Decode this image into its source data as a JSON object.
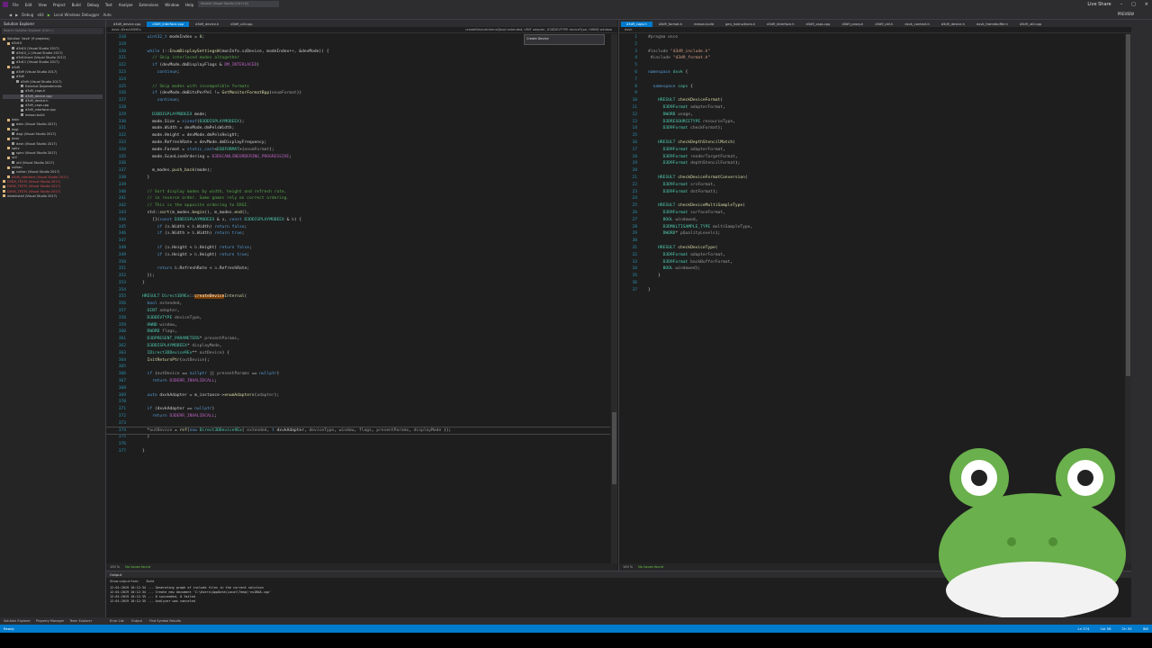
{
  "menu": [
    "File",
    "Edit",
    "View",
    "Project",
    "Build",
    "Debug",
    "Test",
    "Analyze",
    "Extensions",
    "Window",
    "Help"
  ],
  "toolbar": [
    "Debug",
    "x64",
    "Local Windows Debugger",
    "Auto"
  ],
  "search_placeholder": "Search Visual Studio (Ctrl+Q)",
  "window_controls": {
    "live_share": "Live Share",
    "preview": "PREVIEW"
  },
  "solution_explorer": {
    "title": "Solution Explorer",
    "search_placeholder": "Search Solution Explorer (Ctrl+;)",
    "items": [
      {
        "label": "Solution 'dxvk' (9 projects)",
        "indent": 0,
        "color": "#c8c8c8",
        "sel": false
      },
      {
        "label": "d3d10",
        "indent": 1,
        "color": "#c8c8c8",
        "sel": false
      },
      {
        "label": "d3d10 (Visual Studio 2017)",
        "indent": 2,
        "color": "#c8c8c8",
        "sel": false
      },
      {
        "label": "d3d10_1 (Visual Studio 2017)",
        "indent": 2,
        "color": "#c8c8c8",
        "sel": false
      },
      {
        "label": "d3d10core (Visual Studio 2017)",
        "indent": 2,
        "color": "#c8c8c8",
        "sel": false
      },
      {
        "label": "d3d11 (Visual Studio 2017)",
        "indent": 2,
        "color": "#c8c8c8",
        "sel": false
      },
      {
        "label": "d3d9",
        "indent": 1,
        "color": "#c8c8c8",
        "sel": false
      },
      {
        "label": "d3d9 (Visual Studio 2017)",
        "indent": 2,
        "color": "#c8c8c8",
        "sel": false
      },
      {
        "label": "d3d9",
        "indent": 2,
        "color": "#c8c8c8",
        "sel": false
      },
      {
        "label": "d3d9 (Visual Studio 2017)",
        "indent": 3,
        "color": "#c8c8c8",
        "sel": false
      },
      {
        "label": "External Dependencies",
        "indent": 4,
        "color": "#c8c8c8",
        "sel": false
      },
      {
        "label": "d3d9_caps.h",
        "indent": 4,
        "color": "#c8c8c8",
        "sel": false
      },
      {
        "label": "d3d9_device.cpp",
        "indent": 4,
        "color": "#c8c8c8",
        "sel": true
      },
      {
        "label": "d3d9_device.h",
        "indent": 4,
        "color": "#c8c8c8",
        "sel": false
      },
      {
        "label": "d3d9_caps.cpp",
        "indent": 4,
        "color": "#c8c8c8",
        "sel": false
      },
      {
        "label": "d3d9_interface.cpp",
        "indent": 4,
        "color": "#c8c8c8",
        "sel": false
      },
      {
        "label": "meson.build",
        "indent": 4,
        "color": "#c8c8c8",
        "sel": false
      },
      {
        "label": "dxbc",
        "indent": 1,
        "color": "#c8c8c8",
        "sel": false
      },
      {
        "label": "dxbc (Visual Studio 2017)",
        "indent": 2,
        "color": "#c8c8c8",
        "sel": false
      },
      {
        "label": "dxgi",
        "indent": 1,
        "color": "#c8c8c8",
        "sel": false
      },
      {
        "label": "dxgi (Visual Studio 2017)",
        "indent": 2,
        "color": "#c8c8c8",
        "sel": false
      },
      {
        "label": "dxvk",
        "indent": 1,
        "color": "#c8c8c8",
        "sel": false
      },
      {
        "label": "dxvk (Visual Studio 2017)",
        "indent": 2,
        "color": "#c8c8c8",
        "sel": false
      },
      {
        "label": "spirv",
        "indent": 1,
        "color": "#c8c8c8",
        "sel": false
      },
      {
        "label": "spirv (Visual Studio 2017)",
        "indent": 2,
        "color": "#c8c8c8",
        "sel": false
      },
      {
        "label": "util",
        "indent": 1,
        "color": "#c8c8c8",
        "sel": false
      },
      {
        "label": "util (Visual Studio 2017)",
        "indent": 2,
        "color": "#c8c8c8",
        "sel": false
      },
      {
        "label": "vulkan",
        "indent": 1,
        "color": "#c8c8c8",
        "sel": false
      },
      {
        "label": "vulkan (Visual Studio 2017)",
        "indent": 2,
        "color": "#c8c8c8",
        "sel": false
      },
      {
        "label": "d3d9_interface (Visual Studio 2017)",
        "indent": 1,
        "color": "#e05252",
        "sel": false
      },
      {
        "label": "D3D9_TESTS (Visual Studio 2017)",
        "indent": 0,
        "color": "#e05252",
        "sel": false
      },
      {
        "label": "DXVK_TESTS (Visual Studio 2017)",
        "indent": 0,
        "color": "#e05252",
        "sel": false
      },
      {
        "label": "DXVK_TESTS (Visual Studio 2017)",
        "indent": 0,
        "color": "#e05252",
        "sel": false
      },
      {
        "label": "wineinstall (Visual Studio 2017)",
        "indent": 0,
        "color": "#c8c8c8",
        "sel": false
      }
    ],
    "footer": [
      "Solution Explorer",
      "Property Manager",
      "Team Explorer"
    ]
  },
  "left_tabs": [
    {
      "label": "d3d9_device.cpp",
      "active": false
    },
    {
      "label": "d3d9_interface.cpp",
      "active": true
    },
    {
      "label": "d3d9_device.h",
      "active": false
    },
    {
      "label": "d3d9_util.cpp",
      "active": false
    }
  ],
  "left_nav": {
    "scope": "dxvk::Direct3D9Ex",
    "member": "createDeviceInternal(bool extended, UINT adapter, D3DDEVTYPE deviceType, HWND window"
  },
  "find_box": {
    "label": "Create Device"
  },
  "left_code": [
    {
      "n": "318",
      "t": "  <kw>uint32_t</kw> modeIndex = <num>0</num>;"
    },
    {
      "n": "319",
      "t": ""
    },
    {
      "n": "320",
      "t": "  <kw>while</kw> (::<fn>EnumDisplaySettingsW</fn>(monInfo.szDevice, modeIndex++, &devMode)) {"
    },
    {
      "n": "321",
      "t": "    <cm>// Skip interlaced modes altogether</cm>"
    },
    {
      "n": "322",
      "t": "    <kw>if</kw> (devMode.dmDisplayFlags & <mc>DM_INTERLACED</mc>)"
    },
    {
      "n": "323",
      "t": "      <kw>continue</kw>;"
    },
    {
      "n": "324",
      "t": ""
    },
    {
      "n": "325",
      "t": "    <cm>// Skip modes with incompatible formats</cm>"
    },
    {
      "n": "326",
      "t": "    <kw>if</kw> (devMode.dmBitsPerPel != <fn>GetMonitorFormatBpp</fn>(<pr>enumFormat</pr>))"
    },
    {
      "n": "327",
      "t": "      <kw>continue</kw>;"
    },
    {
      "n": "328",
      "t": ""
    },
    {
      "n": "329",
      "t": "    <ty>D3DDISPLAYMODEEX</ty> mode;"
    },
    {
      "n": "330",
      "t": "    mode.Size = <kw>sizeof</kw>(<ty>D3DDISPLAYMODEEX</ty>);"
    },
    {
      "n": "331",
      "t": "    mode.Width = devMode.dmPelsWidth;"
    },
    {
      "n": "332",
      "t": "    mode.Height = devMode.dmPelsHeight;"
    },
    {
      "n": "333",
      "t": "    mode.RefreshRate = devMode.dmDisplayFrequency;"
    },
    {
      "n": "334",
      "t": "    mode.Format = <kw>static_cast</kw><<ty>D3DFORMAT</ty>>(<pr>enumFormat</pr>);"
    },
    {
      "n": "335",
      "t": "    mode.ScanLineOrdering = <mc>D3DSCANLINEORDERING_PROGRESSIVE</mc>;"
    },
    {
      "n": "336",
      "t": ""
    },
    {
      "n": "337",
      "t": "    m_modes.<fn>push_back</fn>(mode);"
    },
    {
      "n": "338",
      "t": "  }"
    },
    {
      "n": "339",
      "t": ""
    },
    {
      "n": "340",
      "t": "  <cm>// Sort display modes by width, height and refresh rate,</cm>"
    },
    {
      "n": "341",
      "t": "  <cm>// in reverse order. Some games rely on correct ordering.</cm>"
    },
    {
      "n": "342",
      "t": "  <cm>// This is the opposite ordering to DXGI.</cm>"
    },
    {
      "n": "343",
      "t": "  std::<fn>sort</fn>(m_modes.<fn>begin</fn>(), m_modes.<fn>end</fn>(),"
    },
    {
      "n": "344",
      "t": "    [](<kw>const</kw> <ty>D3DDISPLAYMODEEX</ty> & <pr>a</pr>, <kw>const</kw> <ty>D3DDISPLAYMODEEX</ty> & <pr>b</pr>) {"
    },
    {
      "n": "345",
      "t": "      <kw>if</kw> (<pr>a</pr>.Width < <pr>b</pr>.Width) <kw>return false</kw>;"
    },
    {
      "n": "346",
      "t": "      <kw>if</kw> (<pr>a</pr>.Width > <pr>b</pr>.Width) <kw>return true</kw>;"
    },
    {
      "n": "347",
      "t": ""
    },
    {
      "n": "348",
      "t": "      <kw>if</kw> (<pr>a</pr>.Height < <pr>b</pr>.Height) <kw>return false</kw>;"
    },
    {
      "n": "349",
      "t": "      <kw>if</kw> (<pr>a</pr>.Height > <pr>b</pr>.Height) <kw>return true</kw>;"
    },
    {
      "n": "350",
      "t": ""
    },
    {
      "n": "351",
      "t": "      <kw>return</kw> <pr>b</pr>.RefreshRate < <pr>a</pr>.RefreshRate;"
    },
    {
      "n": "352",
      "t": "  });"
    },
    {
      "n": "353",
      "t": "}"
    },
    {
      "n": "354",
      "t": ""
    },
    {
      "n": "355",
      "t": "<ty>HRESULT</ty> <ty>Direct3D9Ex</ty>::<hl>createDevice</hl><fn>Internal</fn>("
    },
    {
      "n": "356",
      "t": "  <kw>bool</kw> <pr>extended</pr>,"
    },
    {
      "n": "357",
      "t": "  <ty>UINT</ty> <pr>adapter</pr>,"
    },
    {
      "n": "358",
      "t": "  <ty>D3DDEVTYPE</ty> <pr>deviceType</pr>,"
    },
    {
      "n": "359",
      "t": "  <ty>HWND</ty> <pr>window</pr>,"
    },
    {
      "n": "360",
      "t": "  <ty>DWORD</ty> <pr>flags</pr>,"
    },
    {
      "n": "361",
      "t": "  <ty>D3DPRESENT_PARAMETERS</ty>* <pr>presentParams</pr>,"
    },
    {
      "n": "362",
      "t": "  <ty>D3DDISPLAYMODEEX</ty>* <pr>displayMode</pr>,"
    },
    {
      "n": "363",
      "t": "  <ty>IDirect3DDevice9Ex</ty>** <pr>outDevice</pr>) {"
    },
    {
      "n": "364",
      "t": "  <fn>InitReturnPtr</fn>(<pr>outDevice</pr>);"
    },
    {
      "n": "365",
      "t": ""
    },
    {
      "n": "366",
      "t": "  <kw>if</kw> (<pr>outDevice</pr> == <kw>nullptr</kw> || <pr>presentParams</pr> == <kw>nullptr</kw>)"
    },
    {
      "n": "367",
      "t": "    <kw>return</kw> <mc>D3DERR_INVALIDCALL</mc>;"
    },
    {
      "n": "368",
      "t": ""
    },
    {
      "n": "369",
      "t": "  <kw>auto</kw> dxvkAdapter = m_instance-><fn>enumAdapters</fn>(<pr>adapter</pr>);"
    },
    {
      "n": "370",
      "t": ""
    },
    {
      "n": "371",
      "t": "  <kw>if</kw> (dxvkAdapter == <kw>nullptr</kw>)"
    },
    {
      "n": "372",
      "t": "    <kw>return</kw> <mc>D3DERR_INVALIDCALL</mc>;"
    },
    {
      "n": "373",
      "t": ""
    },
    {
      "n": "374",
      "t": "  *<pr>outDevice</pr> = <fn>ref</fn>(<kw>new</kw> <ty>Direct3DDevice9Ex</ty>( <pr>extended</pr>, <kw>t</kw> dxvkAdapter, <pr>deviceType</pr>, <pr>window</pr>, <pr>flags</pr>, <pr>presentParams</pr>, <pr>displayMode</pr> ));"
    },
    {
      "n": "375",
      "t": "  }"
    },
    {
      "n": "376",
      "t": ""
    },
    {
      "n": "377",
      "t": "}"
    }
  ],
  "left_status": [
    "100 %",
    "No issues found"
  ],
  "right_tabs": [
    {
      "label": "d3d9_caps.h",
      "active": true
    },
    {
      "label": "d3d9_format.h",
      "active": false
    },
    {
      "label": "meson.build",
      "active": false
    },
    {
      "label": "gen_instructions.h",
      "active": false
    },
    {
      "label": "d3d9_interface.h",
      "active": false
    },
    {
      "label": "d3d9_caps.cpp",
      "active": false
    },
    {
      "label": "d3d9_proxy.h",
      "active": false
    },
    {
      "label": "d3d9_util.h",
      "active": false
    },
    {
      "label": "dxvk_context.h",
      "active": false
    },
    {
      "label": "d3d9_device.h",
      "active": false
    },
    {
      "label": "dxvk_framebuffer.h",
      "active": false
    },
    {
      "label": "d3d9_util.cpp",
      "active": false
    }
  ],
  "right_nav": {
    "scope": "dxvk"
  },
  "right_code": [
    {
      "n": "1",
      "t": "<pr>#pragma once</pr>"
    },
    {
      "n": "2",
      "t": ""
    },
    {
      "n": "3",
      "t": "<pr>#include</pr> <st>\"d3d9_include.h\"</st>"
    },
    {
      "n": "4",
      "t": " <pr>#include</pr> <st>\"d3d9_format.h\"</st>"
    },
    {
      "n": "5",
      "t": ""
    },
    {
      "n": "6",
      "t": "<kw>namespace</kw> <ty>dxvk</ty> {"
    },
    {
      "n": "7",
      "t": ""
    },
    {
      "n": "8",
      "t": "  <kw>namespace</kw> <ty>caps</ty> {"
    },
    {
      "n": "9",
      "t": ""
    },
    {
      "n": "10",
      "t": "    <ty>HRESULT</ty> <fn>checkDeviceFormat</fn>("
    },
    {
      "n": "11",
      "t": "      <ty>D3D9Format</ty> <pr>adapterFormat</pr>,"
    },
    {
      "n": "12",
      "t": "      <ty>DWORD</ty> <pr>usage</pr>,"
    },
    {
      "n": "13",
      "t": "      <ty>D3DRESOURCETYPE</ty> <pr>resourceType</pr>,"
    },
    {
      "n": "14",
      "t": "      <ty>D3D9Format</ty> <pr>checkFormat</pr>);"
    },
    {
      "n": "15",
      "t": ""
    },
    {
      "n": "16",
      "t": "    <ty>HRESULT</ty> <fn>checkDepthStencilMatch</fn>("
    },
    {
      "n": "17",
      "t": "      <ty>D3D9Format</ty> <pr>adapterFormat</pr>,"
    },
    {
      "n": "18",
      "t": "      <ty>D3D9Format</ty> <pr>renderTargetFormat</pr>,"
    },
    {
      "n": "19",
      "t": "      <ty>D3D9Format</ty> <pr>depthStencilFormat</pr>);"
    },
    {
      "n": "20",
      "t": ""
    },
    {
      "n": "21",
      "t": "    <ty>HRESULT</ty> <fn>checkDeviceFormatConversion</fn>("
    },
    {
      "n": "22",
      "t": "      <ty>D3D9Format</ty> <pr>srcFormat</pr>,"
    },
    {
      "n": "23",
      "t": "      <ty>D3D9Format</ty> <pr>dstFormat</pr>);"
    },
    {
      "n": "24",
      "t": ""
    },
    {
      "n": "25",
      "t": "    <ty>HRESULT</ty> <fn>checkDeviceMultiSampleType</fn>("
    },
    {
      "n": "26",
      "t": "      <ty>D3D9Format</ty> <pr>surfaceFormat</pr>,"
    },
    {
      "n": "27",
      "t": "      <ty>BOOL</ty> <pr>windowed</pr>,"
    },
    {
      "n": "28",
      "t": "      <ty>D3DMULTISAMPLE_TYPE</ty> <pr>multiSampleType</pr>,"
    },
    {
      "n": "29",
      "t": "      <ty>DWORD</ty>* <pr>pQualityLevels</pr>);"
    },
    {
      "n": "30",
      "t": ""
    },
    {
      "n": "31",
      "t": "    <ty>HRESULT</ty> <fn>checkDeviceType</fn>("
    },
    {
      "n": "32",
      "t": "      <ty>D3D9Format</ty> <pr>adapterFormat</pr>,"
    },
    {
      "n": "33",
      "t": "      <ty>D3D9Format</ty> <pr>backBufferFormat</pr>,"
    },
    {
      "n": "34",
      "t": "      <ty>BOOL</ty> <pr>windowed</pr>);"
    },
    {
      "n": "35",
      "t": "    }"
    },
    {
      "n": "36",
      "t": ""
    },
    {
      "n": "37",
      "t": "}"
    }
  ],
  "right_status": [
    "100 %",
    "No issues found"
  ],
  "output": {
    "title": "Output",
    "show_from_label": "Show output from:",
    "show_from_value": "Build",
    "lines": [
      "12:01:2019 10:12:34 ... Generating graph of include files in the current solution",
      "12:01:2019 10:12:34 ... Create new document 'C:\\Users\\AppData\\Local\\Temp\\~vs1B0A.cpp'",
      "12:01:2019 10:12:35 ... 0 succeeded, 0 failed",
      "12:01:2019 10:12:35 ... Analyzer was canceled"
    ],
    "tabs": [
      "Error List",
      "Output",
      "Find Symbol Results"
    ]
  },
  "status": {
    "left": "Ready",
    "ln": "Ln 374",
    "col": "Col 58",
    "ch": "Ch 55",
    "ins": "INS"
  },
  "colors": {
    "accent": "#007acc",
    "frog_body": "#6ab04c",
    "frog_belly": "#f2f2f2"
  }
}
